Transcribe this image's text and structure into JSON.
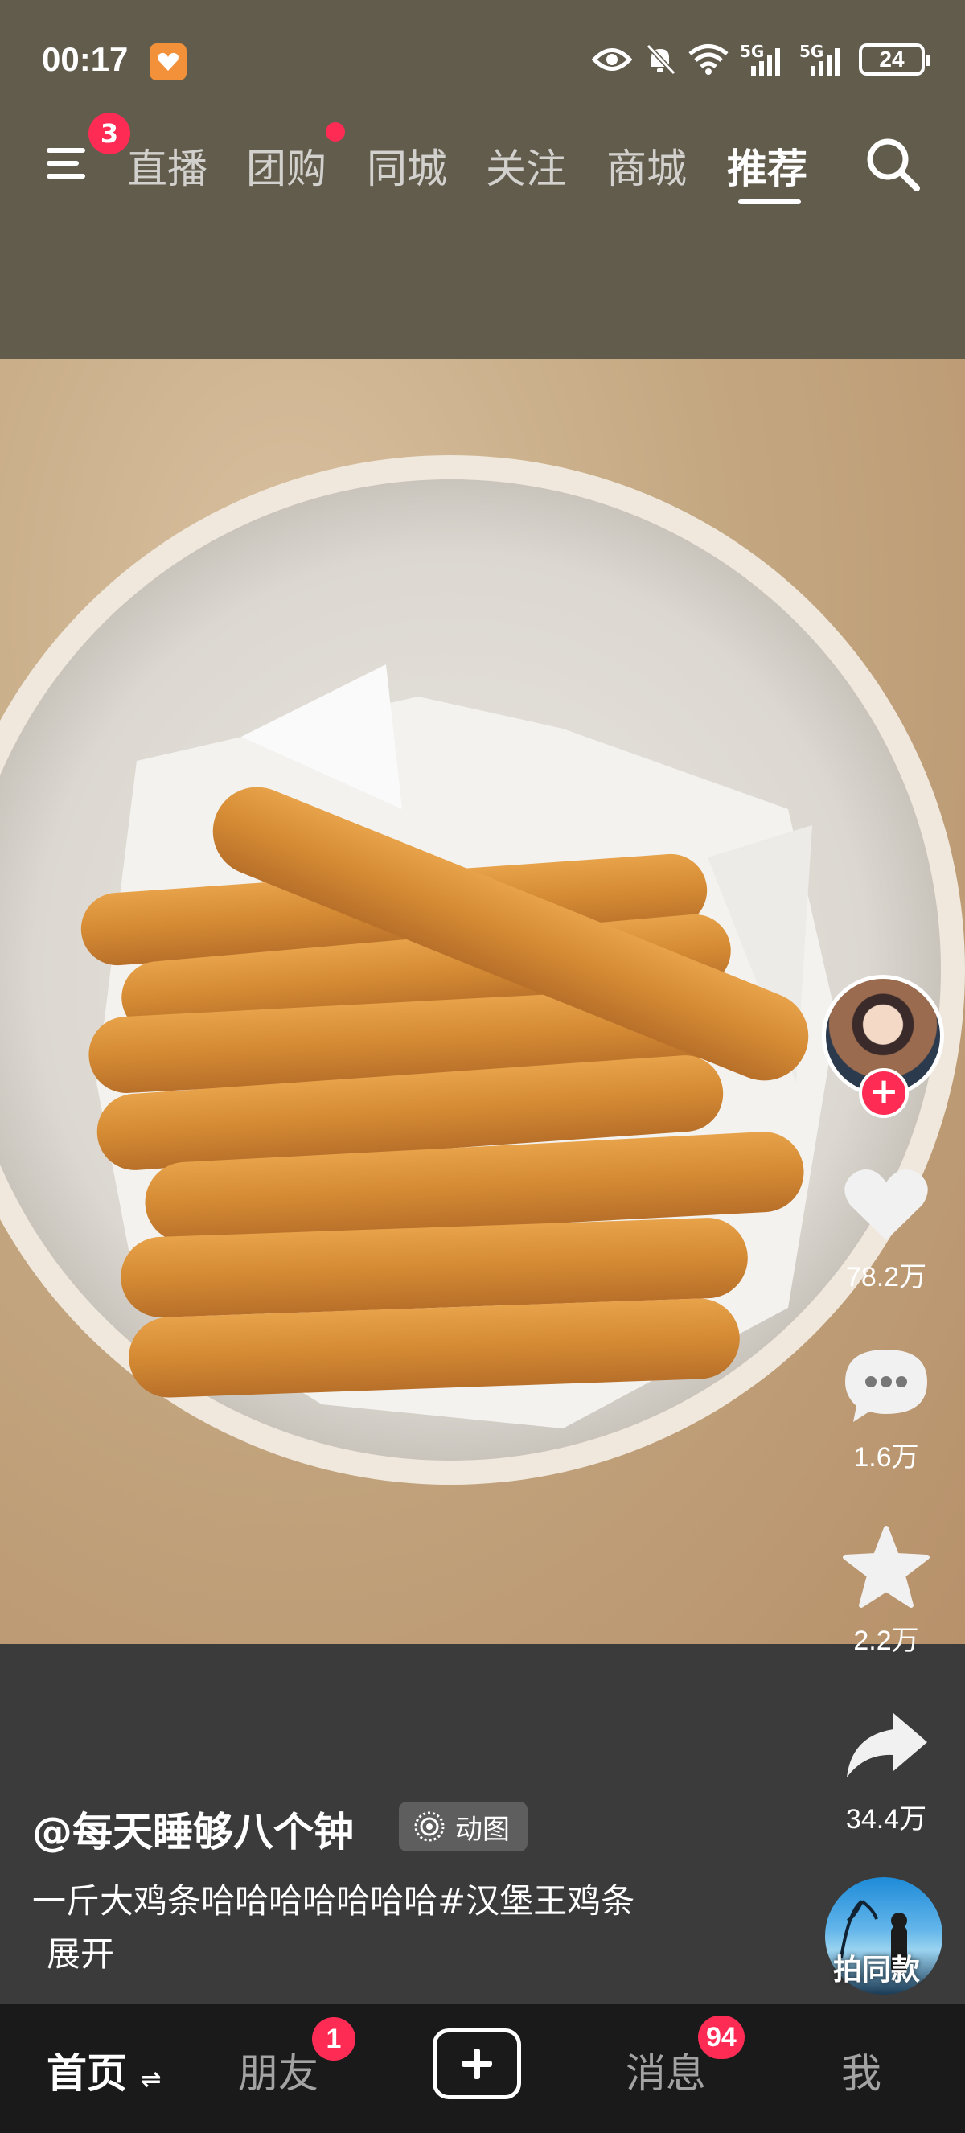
{
  "status_bar": {
    "time": "00:17",
    "battery": "24",
    "network_1": "5G",
    "network_2": "5G"
  },
  "top_nav": {
    "menu_badge": "3",
    "tabs": [
      {
        "label": "直播"
      },
      {
        "label": "团购"
      },
      {
        "label": "同城"
      },
      {
        "label": "关注"
      },
      {
        "label": "商城"
      },
      {
        "label": "推荐"
      }
    ],
    "active_tab": "推荐"
  },
  "video": {
    "author": "@每天睡够八个钟",
    "gif_tag": "动图",
    "caption": "一斤大鸡条哈哈哈哈哈哈哈#汉堡王鸡条",
    "expand": "展开"
  },
  "actions": {
    "likes": "78.2万",
    "comments": "1.6万",
    "favorites": "2.2万",
    "shares": "34.4万",
    "same_style": "拍同款"
  },
  "bottom_nav": {
    "items": [
      {
        "label": "首页"
      },
      {
        "label": "朋友"
      },
      {
        "label": "消息"
      },
      {
        "label": "我"
      }
    ],
    "friends_badge": "1",
    "messages_badge": "94"
  },
  "colors": {
    "accent": "#fe2c55",
    "header_bg": "#625c4d",
    "nav_bg": "#1a1a1a"
  }
}
